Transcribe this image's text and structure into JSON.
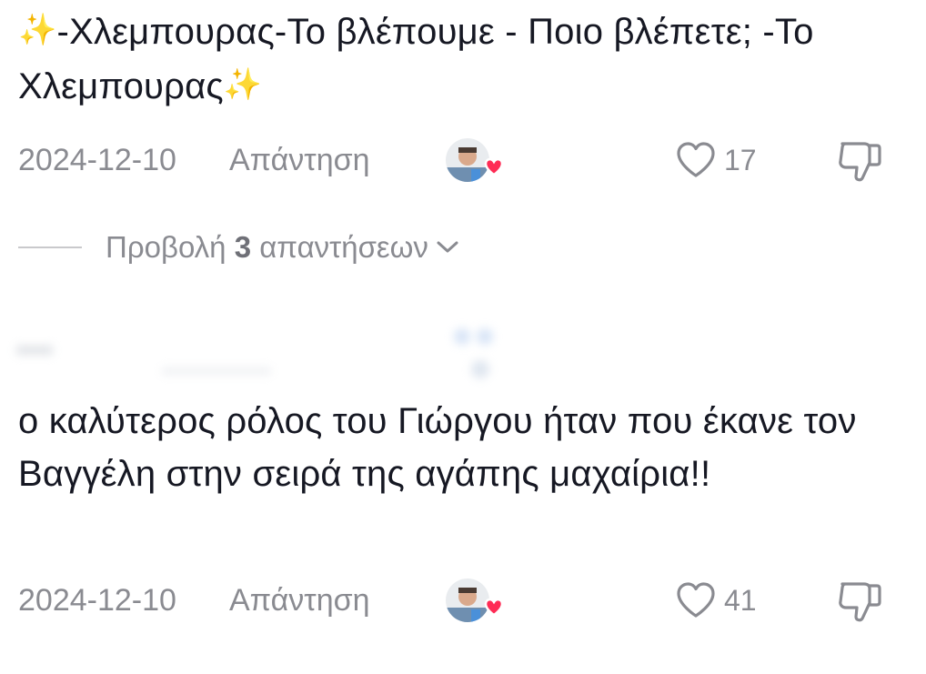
{
  "comments": [
    {
      "sparkle_left": "✨",
      "text": "-Χλεμπουρας-Το βλέπουμε - Ποιο βλέπετε; -Το Χλεμπουρας",
      "sparkle_right": "✨",
      "date": "2024-12-10",
      "reply_label": "Απάντηση",
      "likes": "17",
      "icons": {
        "creator_avatar": "creator-avatar-with-heart",
        "like": "heart-outline-icon",
        "dislike": "thumbs-down-icon"
      }
    },
    {
      "text": "ο καλύτερος ρόλος του Γιώργου ήταν που έκανε τον Βαγγέλη στην σειρά της αγάπης μαχαίρια!!",
      "date": "2024-12-10",
      "reply_label": "Απάντηση",
      "likes": "41",
      "icons": {
        "creator_avatar": "creator-avatar-with-heart",
        "like": "heart-outline-icon",
        "dislike": "thumbs-down-icon"
      }
    }
  ],
  "view_replies": {
    "prefix": "Προβολή",
    "count": "3",
    "suffix": "απαντήσεων",
    "icon": "chevron-down-icon"
  },
  "colors": {
    "text_primary": "#161823",
    "text_secondary": "#8a8b91",
    "heart_badge": "#fe2c55",
    "sparkle": "#f5c518"
  }
}
